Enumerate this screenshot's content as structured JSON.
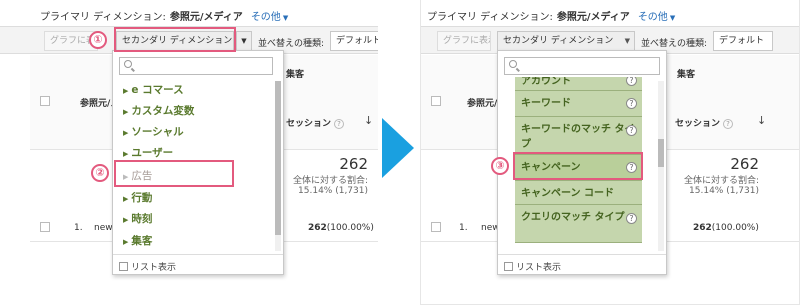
{
  "left": {
    "primary_label": "プライマリ ディメンション:",
    "primary_value": "参照元/メディア",
    "other_link": "その他",
    "graph_btn": "グラフに表示",
    "secondary_dd": "セカンダリ ディメンション",
    "sort_label": "並べ替えの種類:",
    "sort_value": "デフォルト",
    "col_source": "参照元/メディア",
    "col_acq": "集客",
    "col_sessions": "セッション",
    "total": "262",
    "total_label": "全体に対する割合:",
    "total_pct": "15.14% (1,731)",
    "row_num": "1.",
    "row_src": "new",
    "row_val": "262",
    "row_pct": "(100.00%)",
    "search_placeholder": "",
    "menu_items": [
      "e コマース",
      "カスタム変数",
      "ソーシャル",
      "ユーザー",
      "広告",
      "行動",
      "時刻",
      "集客"
    ],
    "list_view": "リスト表示",
    "badge1": "①",
    "badge2": "②"
  },
  "right": {
    "primary_label": "プライマリ ディメンション:",
    "primary_value": "参照元/メディア",
    "other_link": "その他",
    "graph_btn": "グラフに表示",
    "secondary_dd": "セカンダリ ディメンション",
    "sort_label": "並べ替えの種類:",
    "sort_value": "デフォルト",
    "col_source": "参照元/メディア",
    "col_acq": "集客",
    "col_sessions": "セッション",
    "total": "262",
    "total_label": "全体に対する割合:",
    "total_pct": "15.14% (1,731)",
    "row_num": "1.",
    "row_src": "new",
    "row_val": "262",
    "row_pct": "(100.00%)",
    "sub_items": [
      {
        "label": "アカウント"
      },
      {
        "label": "キーワード"
      },
      {
        "label": "キーワードのマッチ タイプ"
      },
      {
        "label": "キャンペーン"
      },
      {
        "label": "キャンペーン コード"
      },
      {
        "label": "クエリのマッチ タイプ"
      }
    ],
    "list_view": "リスト表示",
    "badge3": "③"
  },
  "colors": {
    "highlight": "#e35a7e",
    "arrow": "#1aa0e0",
    "menu_item": "#5a7a2e",
    "sub_item_bg": "#c5d6ad"
  }
}
